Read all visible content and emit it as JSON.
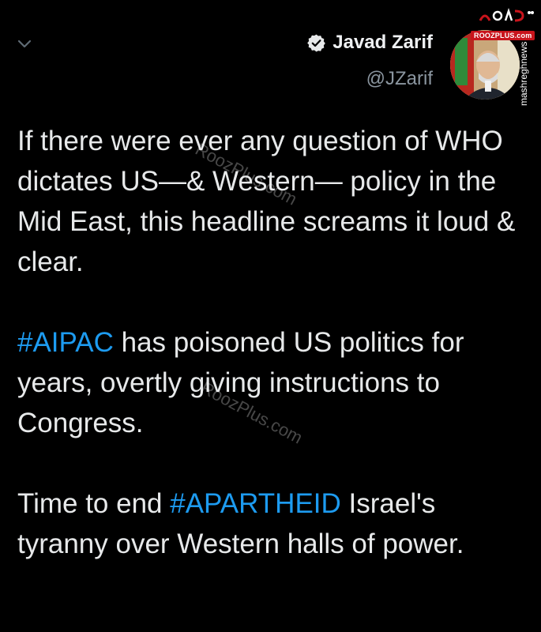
{
  "header": {
    "display_name": "Javad Zarif",
    "handle": "@JZarif",
    "verified": true
  },
  "tweet": {
    "paragraphs": [
      {
        "text": "If there were ever any question of WHO dictates US—& Western— policy in the Mid East, this headline screams it loud & clear."
      },
      {
        "hashtag": "#AIPAC",
        "text": " has poisoned US politics for years, overtly giving instructions to Congress."
      },
      {
        "before": "Time to end ",
        "hashtag": "#APARTHEID",
        "text": " Israel's tyranny over Western halls of power."
      }
    ]
  },
  "watermarks": {
    "badge": "ROOZPLUS.com",
    "side": "mashreghnews",
    "diagonal_1": "RoozPlus.com",
    "diagonal_2": "RoozPlus.com"
  },
  "colors": {
    "background": "#000000",
    "text": "#e7e9ea",
    "hashtag": "#1d9bf0",
    "secondary": "#8b96a0",
    "badge": "#c8141c"
  },
  "icons": {
    "chevron": "chevron-down-icon",
    "verified": "verified-badge-icon"
  }
}
